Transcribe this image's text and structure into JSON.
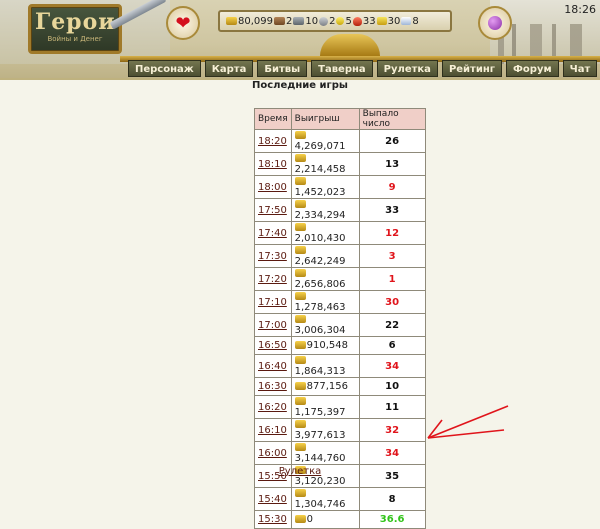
{
  "header": {
    "logo_title": "Герои",
    "logo_subtitle": "Войны и Денег",
    "clock": "18:26",
    "resources": [
      {
        "icon": "gold-icon",
        "value": "80,099"
      },
      {
        "icon": "wood-icon",
        "value": "2"
      },
      {
        "icon": "ore-icon",
        "value": "10"
      },
      {
        "icon": "mercury-icon",
        "value": "2"
      },
      {
        "icon": "sulfur-icon",
        "value": "5"
      },
      {
        "icon": "crystal-icon",
        "value": "33"
      },
      {
        "icon": "gems-icon",
        "value": "30"
      },
      {
        "icon": "diamond-icon",
        "value": "8"
      }
    ],
    "nav": [
      "Персонаж",
      "Карта",
      "Битвы",
      "Таверна",
      "Рулетка",
      "Рейтинг",
      "Форум",
      "Чат"
    ]
  },
  "page": {
    "title": "Последние игры",
    "columns": [
      "Время",
      "Выигрыш",
      "Выпало число"
    ],
    "rows": [
      {
        "time": "18:20",
        "win": "4,269,071",
        "number": "26",
        "color": "black"
      },
      {
        "time": "18:10",
        "win": "2,214,458",
        "number": "13",
        "color": "black"
      },
      {
        "time": "18:00",
        "win": "1,452,023",
        "number": "9",
        "color": "red"
      },
      {
        "time": "17:50",
        "win": "2,334,294",
        "number": "33",
        "color": "black"
      },
      {
        "time": "17:40",
        "win": "2,010,430",
        "number": "12",
        "color": "red"
      },
      {
        "time": "17:30",
        "win": "2,642,249",
        "number": "3",
        "color": "red"
      },
      {
        "time": "17:20",
        "win": "2,656,806",
        "number": "1",
        "color": "red"
      },
      {
        "time": "17:10",
        "win": "1,278,463",
        "number": "30",
        "color": "red"
      },
      {
        "time": "17:00",
        "win": "3,006,304",
        "number": "22",
        "color": "black"
      },
      {
        "time": "16:50",
        "win": "910,548",
        "number": "6",
        "color": "black"
      },
      {
        "time": "16:40",
        "win": "1,864,313",
        "number": "34",
        "color": "red"
      },
      {
        "time": "16:30",
        "win": "877,156",
        "number": "10",
        "color": "black"
      },
      {
        "time": "16:20",
        "win": "1,175,397",
        "number": "11",
        "color": "black"
      },
      {
        "time": "16:10",
        "win": "3,977,613",
        "number": "32",
        "color": "red"
      },
      {
        "time": "16:00",
        "win": "3,144,760",
        "number": "34",
        "color": "red"
      },
      {
        "time": "15:50",
        "win": "3,120,230",
        "number": "35",
        "color": "black"
      },
      {
        "time": "15:40",
        "win": "1,304,746",
        "number": "8",
        "color": "black"
      },
      {
        "time": "15:30",
        "win": "0",
        "number": "36.6",
        "color": "green"
      }
    ],
    "footer_link": "Рулетка"
  },
  "colors": {
    "red": "#e0141b",
    "green": "#32c41a",
    "link": "#5b1a10",
    "header_bg": "#f0cfc8"
  }
}
